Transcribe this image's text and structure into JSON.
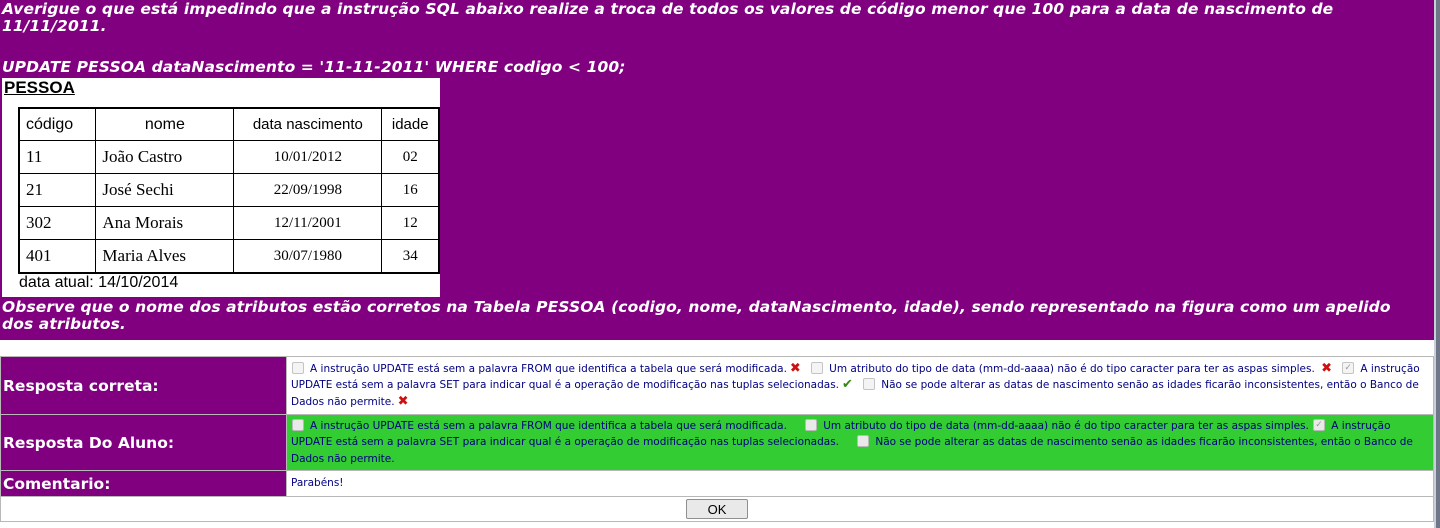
{
  "question": {
    "intro": "Averigue o que está impedindo que a instrução SQL abaixo realize a troca de todos os valores de código menor que 100 para a data de nascimento de 11/11/2011.",
    "sql": "UPDATE PESSOA dataNascimento = '11-11-2011' WHERE codigo < 100;",
    "note": "Observe que o nome dos atributos estão corretos na Tabela PESSOA (codigo, nome, dataNascimento, idade), sendo representado na figura como um apelido dos atributos."
  },
  "figure": {
    "title": "PESSOA",
    "headers": [
      "código",
      "nome",
      "data nascimento",
      "idade"
    ],
    "rows": [
      [
        "11",
        "João Castro",
        "10/01/2012",
        "02"
      ],
      [
        "21",
        "José Sechi",
        "22/09/1998",
        "16"
      ],
      [
        "302",
        "Ana Morais",
        "12/11/2001",
        "12"
      ],
      [
        "401",
        "Maria Alves",
        "30/07/1980",
        "34"
      ]
    ],
    "footer": "data atual: 14/10/2014"
  },
  "correct": {
    "label": "Resposta correta:",
    "options": [
      {
        "text": "A instrução UPDATE está sem a palavra FROM que identifica a tabela que será modificada.",
        "checked": false,
        "mark": "wrong"
      },
      {
        "text": "Um atributo do tipo de data (mm-dd-aaaa) não é do tipo caracter para ter as aspas simples.",
        "checked": false,
        "mark": "wrong"
      },
      {
        "text": "A instrução UPDATE está sem a palavra SET para indicar qual é a operação de modificação nas tuplas selecionadas.",
        "checked": true,
        "mark": "right"
      },
      {
        "text": "Não se pode alterar as datas de nascimento senão as idades ficarão inconsistentes, então o Banco de Dados não permite.",
        "checked": false,
        "mark": "wrong"
      }
    ]
  },
  "student": {
    "label": "Resposta Do Aluno:",
    "options": [
      {
        "text": "A instrução UPDATE está sem a palavra FROM que identifica a tabela que será modificada.",
        "checked": false
      },
      {
        "text": "Um atributo do tipo de data (mm-dd-aaaa) não é do tipo caracter para ter as aspas simples.",
        "checked": false
      },
      {
        "text": "A instrução UPDATE está sem a palavra SET para indicar qual é a operação de modificação nas tuplas selecionadas.",
        "checked": true
      },
      {
        "text": "Não se pode alterar as datas de nascimento senão as idades ficarão inconsistentes, então o Banco de Dados não permite.",
        "checked": false
      }
    ]
  },
  "comment": {
    "label": "Comentario:",
    "text": "Parabéns!"
  },
  "ok_button": "OK",
  "colors": {
    "panel": "#800080",
    "student_highlight": "#33cc33",
    "wrong_mark": "#cc1111",
    "right_mark": "#2e8b10"
  }
}
